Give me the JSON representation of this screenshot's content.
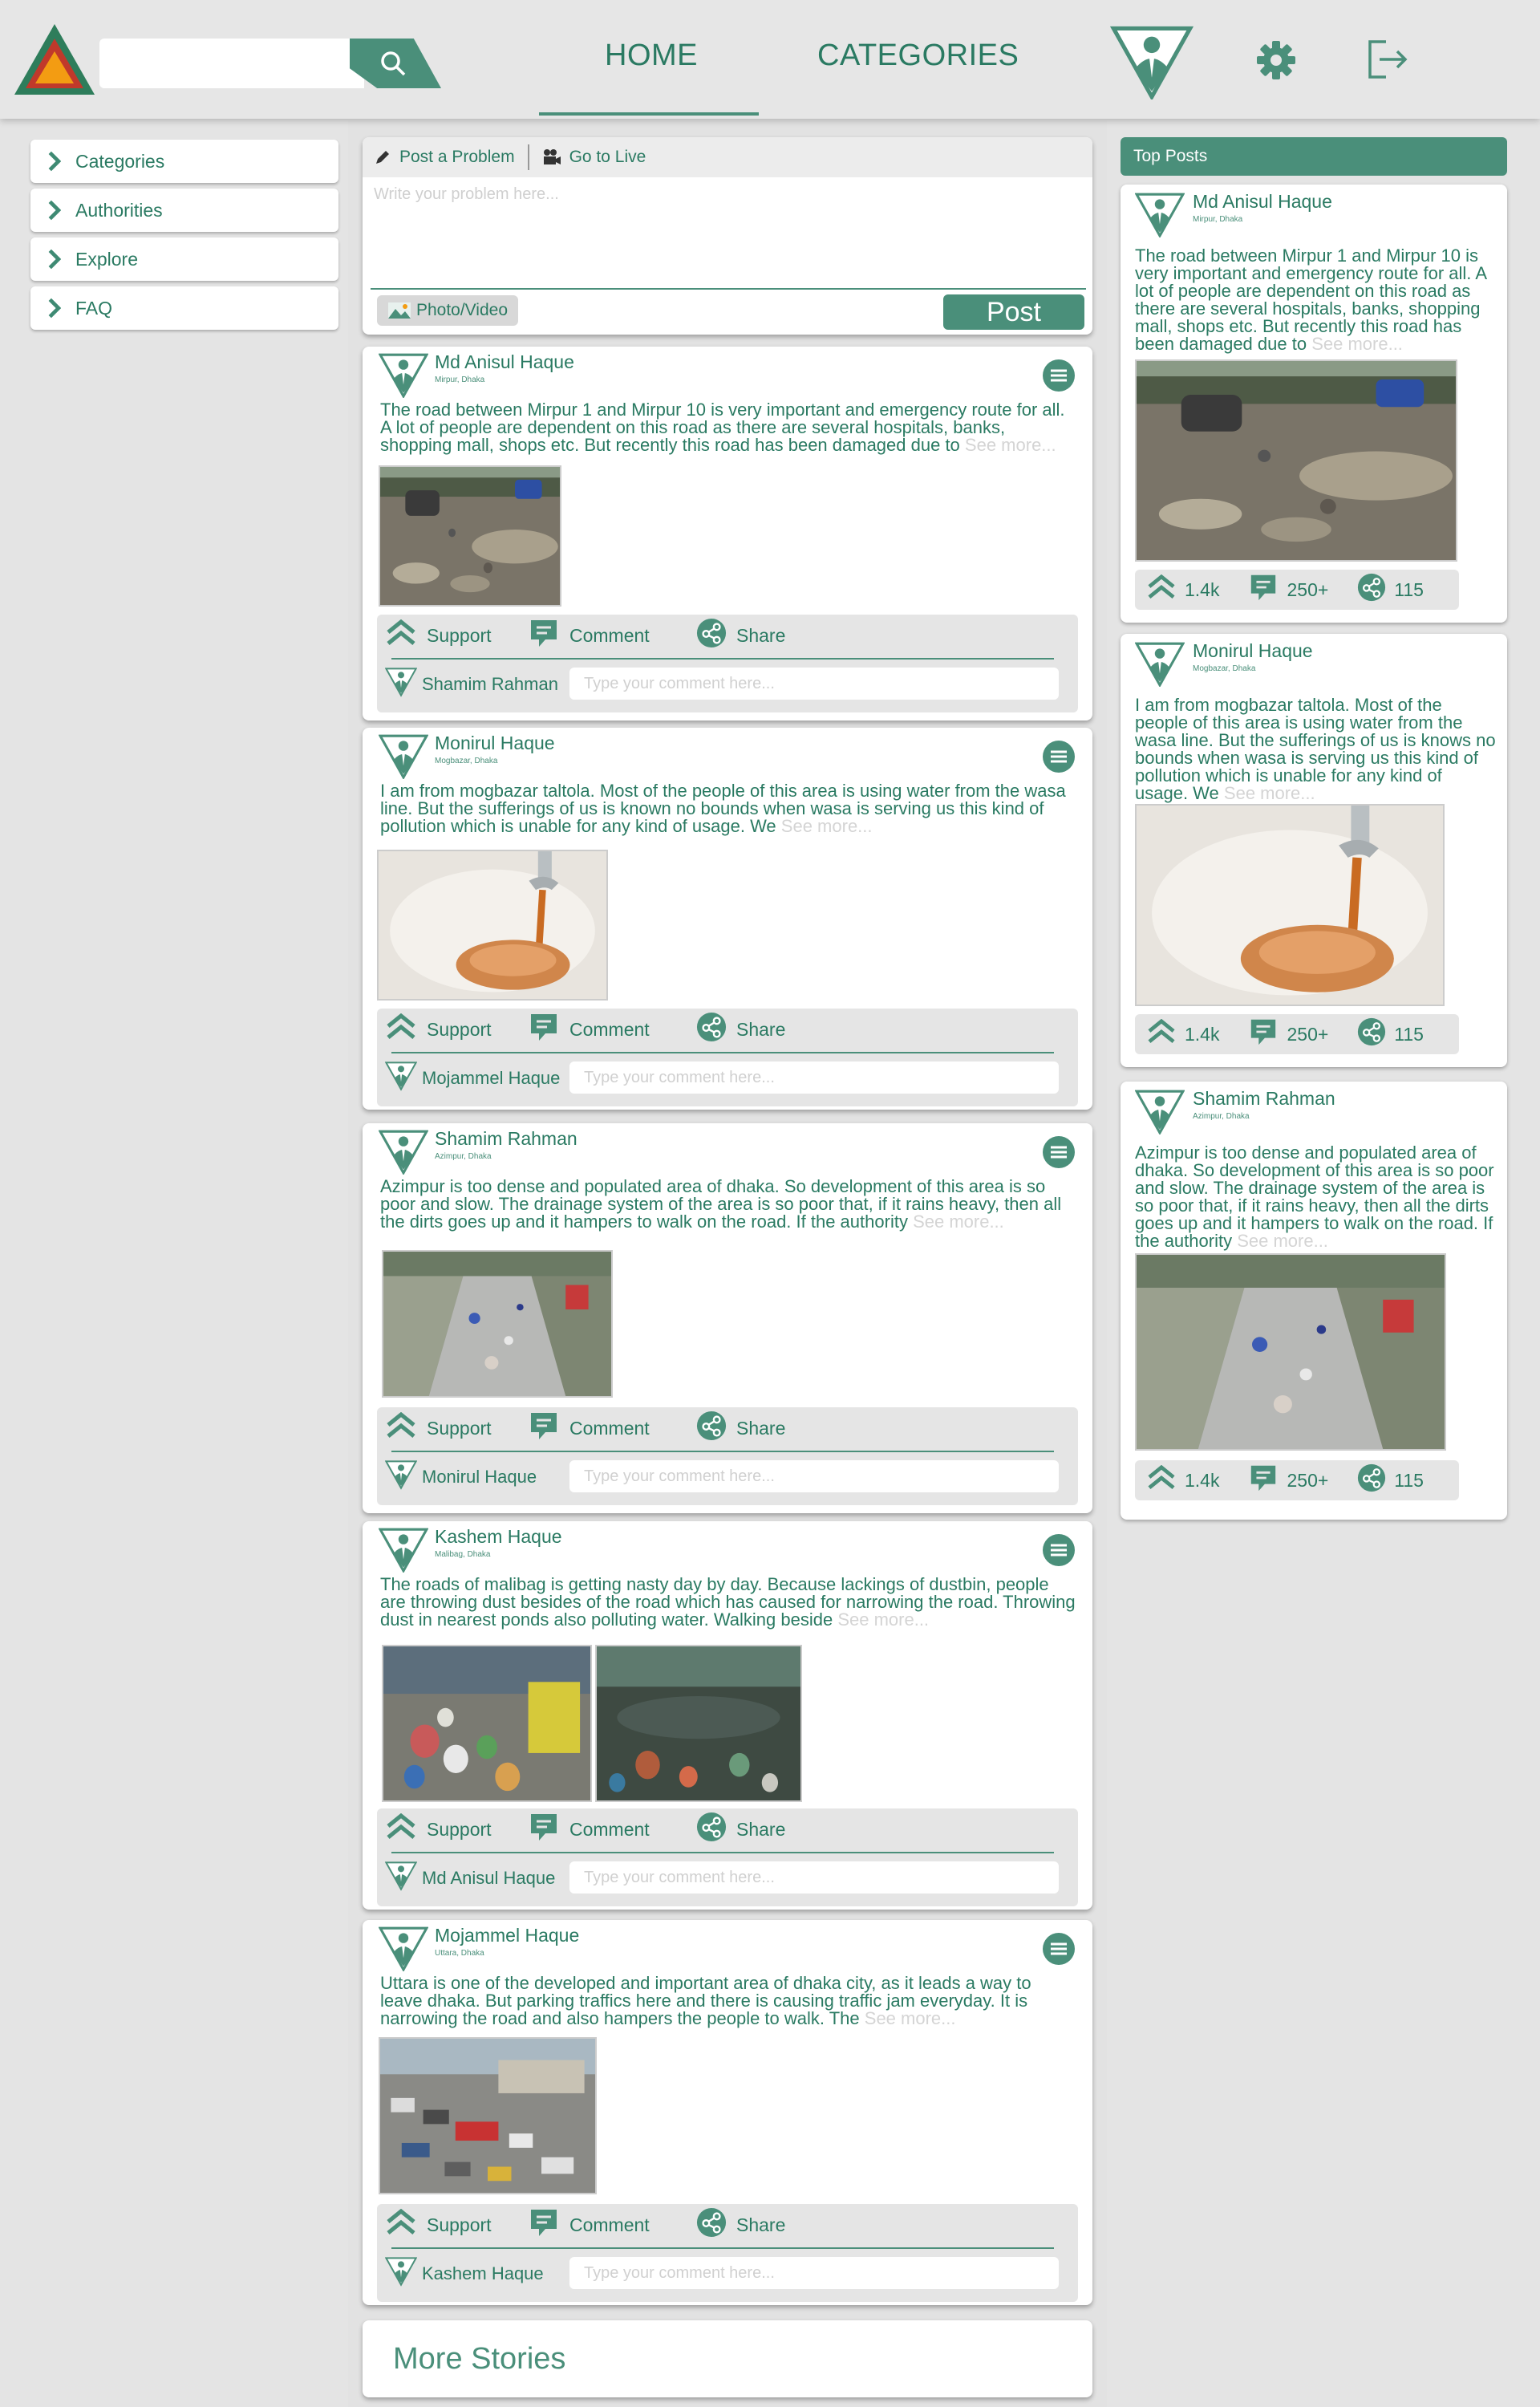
{
  "header": {
    "search_placeholder": "",
    "nav": [
      {
        "label": "HOME",
        "active": true
      },
      {
        "label": "CATEGORIES",
        "active": false
      }
    ],
    "icons": [
      "app-logo",
      "search-icon",
      "user-avatar-icon",
      "gear-icon",
      "logout-icon"
    ]
  },
  "colors": {
    "accent": "#4a8f7a",
    "text": "#2a7a62",
    "background": "#e4e4e4",
    "logo_red": "#c0392b",
    "logo_orange": "#f39c12",
    "logo_green": "#2e7d5b"
  },
  "sidebar": {
    "items": [
      {
        "label": "Categories"
      },
      {
        "label": "Authorities"
      },
      {
        "label": "Explore"
      },
      {
        "label": "FAQ"
      }
    ]
  },
  "composer": {
    "post_problem_label": "Post a Problem",
    "go_live_label": "Go to Live",
    "placeholder": "Write your problem here...",
    "photo_label": "Photo/Video",
    "post_label": "Post"
  },
  "action_labels": {
    "support": "Support",
    "comment": "Comment",
    "share": "Share",
    "see_more": "See more...",
    "comment_placeholder": "Type your comment here..."
  },
  "posts": [
    {
      "author": "Md Anisul Haque",
      "location": "Mirpur, Dhaka",
      "text": "The road between Mirpur 1 and Mirpur 10 is very important and emergency route for all. A lot of people are dependent on this road as there are several hospitals, banks, shopping mall, shops etc. But recently this road has been damaged due to",
      "image_count": 1,
      "commenter": "Shamim Rahman"
    },
    {
      "author": "Monirul Haque",
      "location": "Mogbazar, Dhaka",
      "text": "I am from mogbazar taltola. Most of the people of this area is using water from the wasa line. But the sufferings of us is known no bounds when wasa is serving us this kind of pollution which is unable for any kind of usage. We",
      "image_count": 1,
      "commenter": "Mojammel Haque"
    },
    {
      "author": "Shamim Rahman",
      "location": "Azimpur, Dhaka",
      "text": "Azimpur is too dense and populated area of dhaka. So development of this area is so poor and slow. The drainage system of the area is so poor that, if it rains heavy, then all the dirts goes up and it hampers to walk on the road. If the authority",
      "image_count": 1,
      "commenter": "Monirul Haque"
    },
    {
      "author": "Kashem Haque",
      "location": "Malibag, Dhaka",
      "text": "The roads of malibag is getting nasty day by day. Because lackings of dustbin, people are throwing dust besides of the road which has caused for narrowing the road. Throwing dust in nearest ponds also polluting water. Walking beside",
      "image_count": 2,
      "commenter": "Md Anisul Haque"
    },
    {
      "author": "Mojammel Haque",
      "location": "Uttara, Dhaka",
      "text": "Uttara is one of the developed and important area of dhaka city, as it leads a way to leave dhaka. But parking traffics here and there is causing traffic jam everyday. It is narrowing the road and also hampers the people to walk. The",
      "image_count": 1,
      "commenter": "Kashem Haque"
    }
  ],
  "more_stories_label": "More Stories",
  "top_posts": {
    "title": "Top Posts",
    "items": [
      {
        "author": "Md Anisul Haque",
        "location": "Mirpur, Dhaka",
        "text": "The road between Mirpur 1 and Mirpur 10 is very important and emergency route for all. A lot of people are dependent on this road as there are several hospitals, banks, shopping mall, shops etc. But recently this road has been damaged due to",
        "supports": "1.4k",
        "comments": "250+",
        "shares": "115"
      },
      {
        "author": "Monirul Haque",
        "location": "Mogbazar, Dhaka",
        "text": "I am from mogbazar taltola. Most of the people of this area is using water from the wasa line. But the sufferings of us is knows no bounds when wasa is serving us this kind of pollution which is unable for any kind of usage. We",
        "supports": "1.4k",
        "comments": "250+",
        "shares": "115"
      },
      {
        "author": "Shamim Rahman",
        "location": "Azimpur, Dhaka",
        "text": "Azimpur is too dense and populated area of dhaka. So development of this area is so poor and slow. The drainage system of the area is so poor that, if it rains heavy, then all the dirts goes up and it hampers to walk on the road. If the authority",
        "supports": "1.4k",
        "comments": "250+",
        "shares": "115"
      }
    ]
  }
}
